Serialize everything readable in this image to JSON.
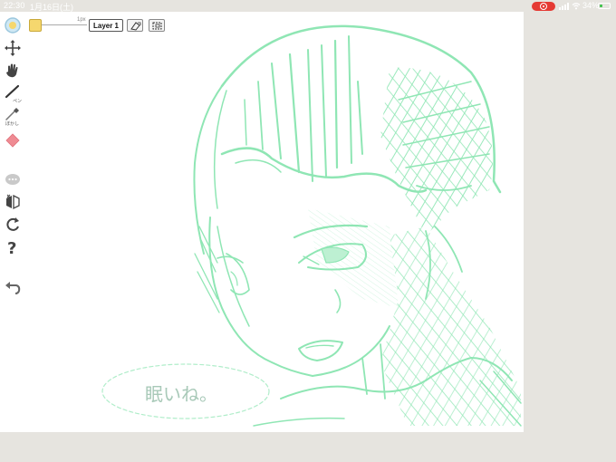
{
  "status_bar": {
    "time": "22:30",
    "date": "1月16日(土)",
    "battery_percent": "34%",
    "battery_level": 0.34,
    "recording_color": "#e53a34"
  },
  "toolbar": {
    "brush_color": "#f5d76e",
    "brush_size_label": "1px",
    "layer_label": "Layer 1",
    "buttons": [
      "eraser-transform-icon",
      "crop-select-icon"
    ]
  },
  "tools": [
    {
      "name": "color-wheel-icon"
    },
    {
      "name": "move-icon"
    },
    {
      "name": "hand-icon"
    },
    {
      "name": "pen-icon",
      "label": "ペン"
    },
    {
      "name": "blur-icon",
      "label": "ぼかし"
    },
    {
      "name": "eraser-icon"
    },
    {
      "name": "chat-icon"
    },
    {
      "name": "flip-icon"
    },
    {
      "name": "redo-icon"
    },
    {
      "name": "help-icon"
    },
    {
      "name": "undo-icon"
    }
  ],
  "canvas": {
    "background": "#ffffff",
    "stroke_color": "#8fe6b4",
    "speech_text": "眠いね。"
  }
}
